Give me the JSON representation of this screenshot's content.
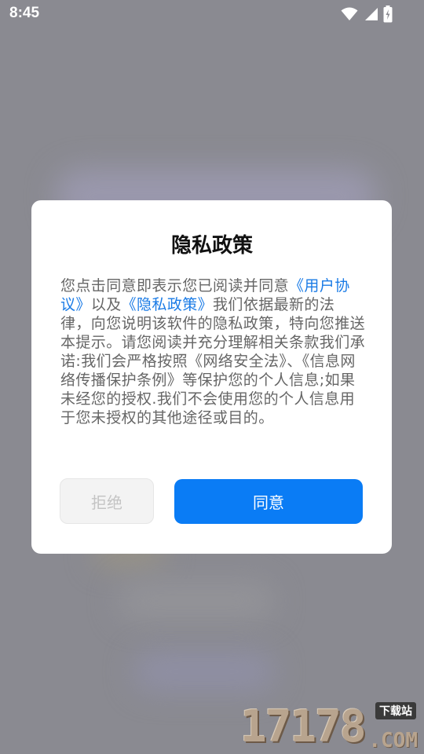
{
  "status_bar": {
    "time": "8:45",
    "icons": [
      "wifi-icon",
      "signal-icon",
      "battery-charging-icon"
    ]
  },
  "dialog": {
    "title": "隐私政策",
    "body": {
      "p1": "您点击同意即表示您已阅读并同意",
      "link_user": "《用户协议》",
      "p2": "以及",
      "link_privacy": "《隐私政策》",
      "p3": "我们依据最新的法律，向您说明该软件的隐私政策，特向您推送本提示。请您阅读并充分理解相关条款我们承诺:我们会严格按照《网络安全法》、《信息网络传播保护条例》等保护您的个人信息;如果未经您的授权.我们不会使用您的个人信息用于您未授权的其他途径或目的。"
    },
    "reject_label": "拒绝",
    "agree_label": "同意"
  },
  "watermark": {
    "digits": "17178",
    "tag": "下载站",
    "suffix": ".COM"
  },
  "colors": {
    "link": "#1a7be6",
    "primary_button": "#0a7cf5",
    "overlay": "#8a8a91"
  }
}
